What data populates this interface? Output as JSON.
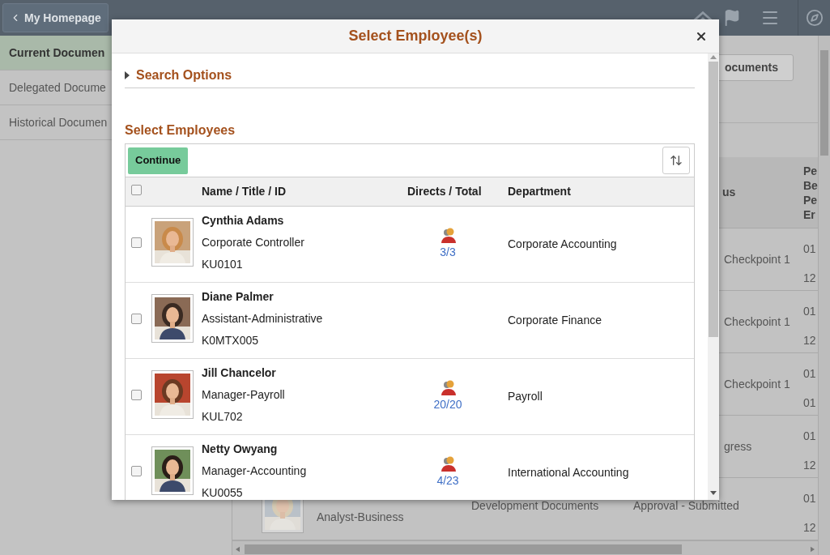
{
  "header": {
    "back_button": "My Homepage"
  },
  "sidebar": {
    "items": [
      {
        "label": "Current Documen",
        "selected": true
      },
      {
        "label": "Delegated Docume",
        "selected": false
      },
      {
        "label": "Historical Documen",
        "selected": false
      }
    ]
  },
  "documents_button": "ocuments",
  "table": {
    "columns": [
      {
        "lines": [
          "us"
        ]
      },
      {
        "lines": [
          "Pe",
          "Be",
          "Pe",
          "Er"
        ]
      }
    ],
    "rows": [
      {
        "kind": "partial",
        "status": "Checkpoint 1",
        "period": [
          "01",
          "12"
        ]
      },
      {
        "kind": "partial",
        "status": "Checkpoint 1",
        "period": [
          "01",
          "12"
        ]
      },
      {
        "kind": "partial",
        "status": "Checkpoint 1",
        "period": [
          "01",
          "01"
        ]
      },
      {
        "kind": "partial",
        "status": "gress",
        "period": [
          "01",
          "12"
        ]
      },
      {
        "kind": "full",
        "title": "Analyst-Business",
        "document": "Development Documents",
        "status": "Approval - Submitted",
        "period": [
          "01",
          "12"
        ]
      }
    ]
  },
  "dialog": {
    "title": "Select Employee(s)",
    "search_options": {
      "label": "Search Options",
      "expanded": false
    },
    "section_title": "Select Employees",
    "continue_button": "Continue",
    "select_all": {
      "checked": false
    },
    "columns": [
      "Name / Title / ID",
      "Directs / Total",
      "Department"
    ],
    "employees": [
      {
        "name": "Cynthia Adams",
        "title": "Corporate Controller",
        "id": "KU0101",
        "directs": "3/3",
        "department": "Corporate Accounting",
        "checked": false
      },
      {
        "name": "Diane Palmer",
        "title": "Assistant-Administrative",
        "id": "K0MTX005",
        "department": "Corporate Finance",
        "checked": false
      },
      {
        "name": "Jill Chancelor",
        "title": "Manager-Payroll",
        "id": "KUL702",
        "directs": "20/20",
        "department": "Payroll",
        "checked": false
      },
      {
        "name": "Netty Owyang",
        "title": "Manager-Accounting",
        "id": "KU0055",
        "directs": "4/23",
        "department": "International Accounting",
        "checked": false
      }
    ]
  }
}
